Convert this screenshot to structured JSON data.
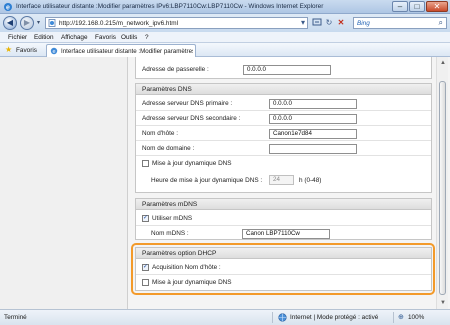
{
  "window": {
    "title": "Interface utilisateur distante :Modifier paramètres IPv6:LBP7110Cw:LBP7110Cw - Windows Internet Explorer",
    "minimize_glyph": "–",
    "maximize_glyph": "□",
    "close_glyph": "✕"
  },
  "navigation": {
    "back_glyph": "◀",
    "forward_glyph": "▶",
    "dropdown_glyph": "▾",
    "url": "http://192.168.0.215/m_network_ipv6.html",
    "refresh_glyph": "↻",
    "stop_glyph": "✕",
    "search_provider": "Bing",
    "search_glyph": "⌕",
    "addr_dropdown_glyph": "▾"
  },
  "menu": {
    "items": [
      "Fichier",
      "Edition",
      "Affichage",
      "Favoris",
      "Outils",
      "?"
    ]
  },
  "favorites_bar": {
    "favorites_label": "Favoris",
    "tab_title": "Interface utilisateur distante :Modifier paramètres..."
  },
  "gateway": {
    "label": "Adresse de passerelle :",
    "value": "0.0.0.0"
  },
  "dns": {
    "title": "Paramètres DNS",
    "primary_label": "Adresse serveur DNS primaire :",
    "primary_value": "0.0.0.0",
    "secondary_label": "Adresse serveur DNS secondaire :",
    "secondary_value": "0.0.0.0",
    "hostname_label": "Nom d'hôte :",
    "hostname_value": "Canon1e7d84",
    "domain_label": "Nom de domaine :",
    "domain_value": "",
    "dynamic_update_label": "Mise à jour dynamique DNS",
    "dynamic_update_checked": false,
    "interval_label": "Heure de mise à jour dynamique DNS :",
    "interval_value": "24",
    "interval_unit": "h (0-48)"
  },
  "mdns": {
    "title": "Paramètres mDNS",
    "use_label": "Utiliser mDNS",
    "use_checked": true,
    "name_label": "Nom mDNS :",
    "name_value": "Canon LBP7110Cw"
  },
  "dhcp": {
    "title": "Paramètres option DHCP",
    "hostname_acquisition_label": "Acquisition Nom d'hôte :",
    "hostname_acquisition_checked": true,
    "dynamic_dns_label": "Mise à jour dynamique DNS",
    "dynamic_dns_checked": false
  },
  "status_bar": {
    "left_text": "Terminé",
    "zone_text": "Internet | Mode protégé : activé",
    "zoom_text": "100%"
  },
  "colors": {
    "highlight": "#f39a2a",
    "checkmark": "#234f9c"
  }
}
